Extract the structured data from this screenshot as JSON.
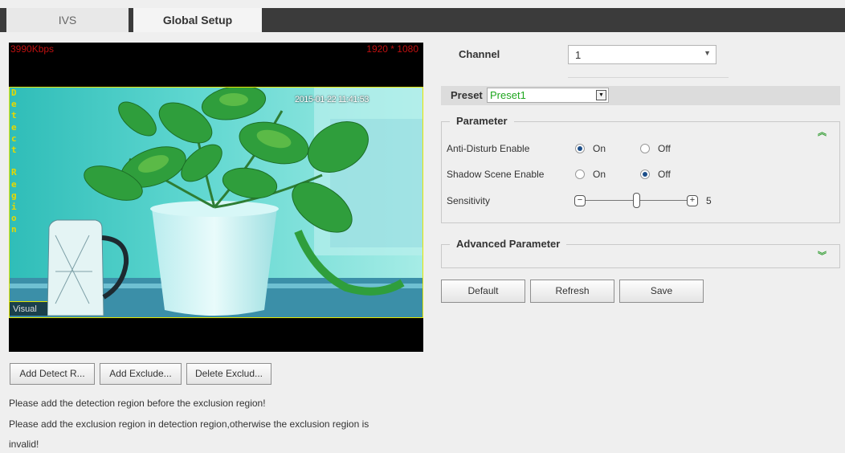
{
  "tabs": [
    {
      "label": "IVS",
      "active": false
    },
    {
      "label": "Global Setup",
      "active": true
    }
  ],
  "video": {
    "bitrate": "3990Kbps",
    "resolution": "1920 * 1080",
    "timestamp": "2015-01-22 11:41:53",
    "region_label_chars": [
      "D",
      "e",
      "t",
      "e",
      "c",
      "t",
      "",
      "R",
      "e",
      "g",
      "i",
      "o",
      "n"
    ],
    "mode_label": "Visual"
  },
  "region_buttons": {
    "add_detect": "Add Detect R...",
    "add_exclude": "Add Exclude...",
    "delete_exclude": "Delete Exclud..."
  },
  "notes": [
    "Please add the detection region before the exclusion region!",
    "Please add the exclusion region in detection region,otherwise the exclusion region is",
    "invalid!"
  ],
  "channel": {
    "label": "Channel",
    "value": "1"
  },
  "preset": {
    "label": "Preset",
    "value": "Preset1"
  },
  "parameter": {
    "title": "Parameter",
    "anti_disturb": {
      "label": "Anti-Disturb Enable",
      "on_label": "On",
      "off_label": "Off",
      "selected": "On"
    },
    "shadow_scene": {
      "label": "Shadow Scene Enable",
      "on_label": "On",
      "off_label": "Off",
      "selected": "Off"
    },
    "sensitivity": {
      "label": "Sensitivity",
      "value": "5",
      "level": 0.5,
      "minus": "−",
      "plus": "+"
    }
  },
  "advanced": {
    "title": "Advanced Parameter"
  },
  "actions": {
    "default": "Default",
    "refresh": "Refresh",
    "save": "Save"
  },
  "colors": {
    "osd_red": "#c01010",
    "region_yellow": "#e6e600",
    "preset_green": "#1ea61e",
    "tab_bar": "#3b3b3b"
  },
  "icons": {
    "collapse": "double-chevron-up-icon",
    "expand": "double-chevron-down-icon",
    "dropdown": "triangle-down-icon"
  }
}
